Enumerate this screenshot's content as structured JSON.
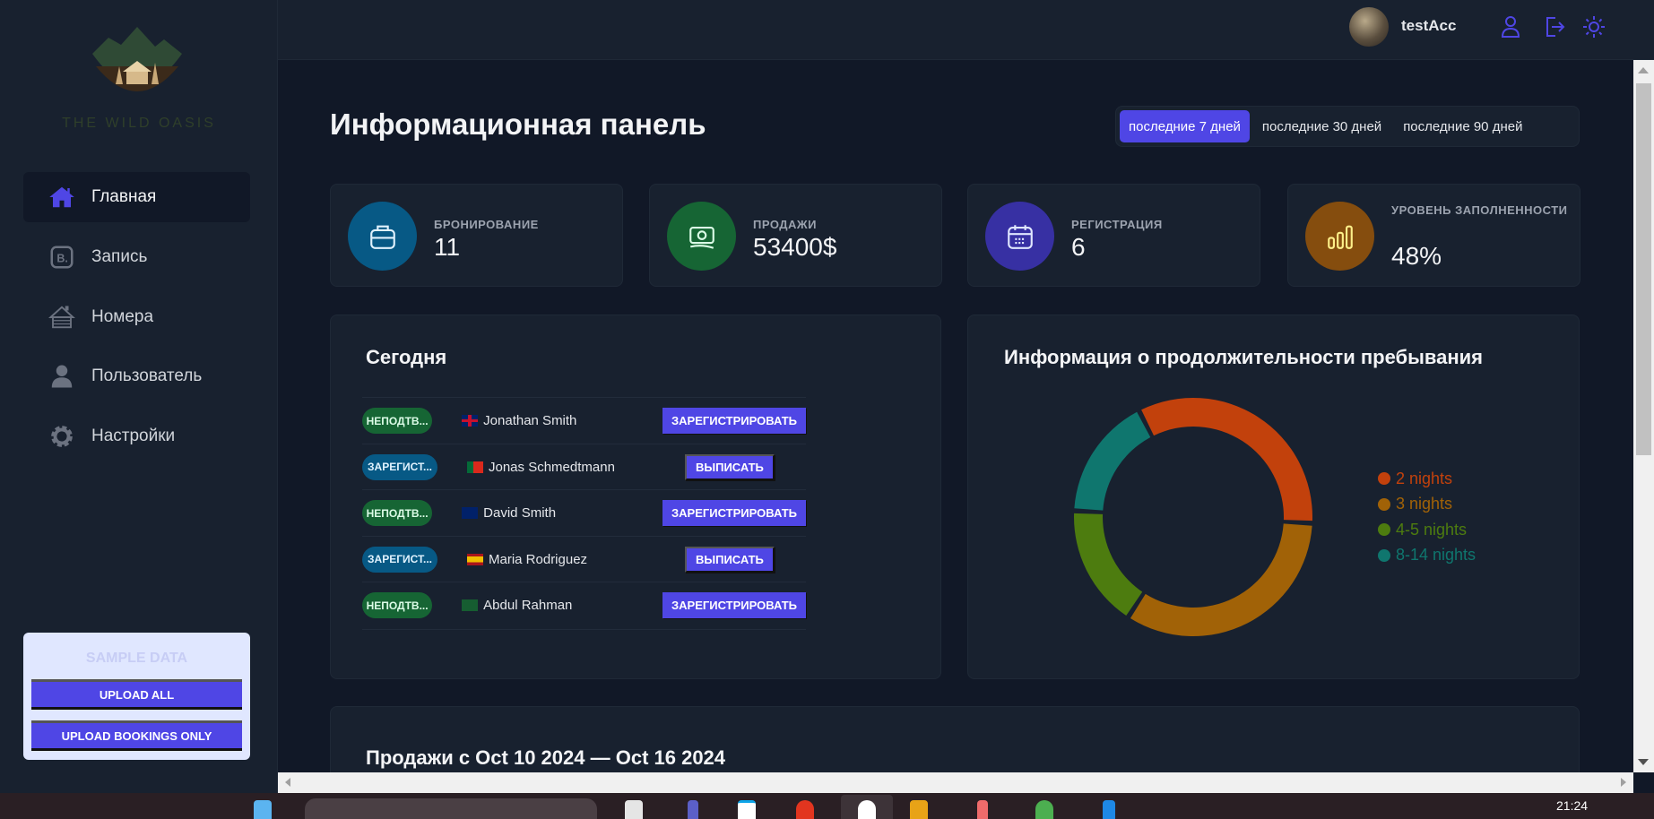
{
  "sidebar": {
    "logo_text": "THE WILD OASIS",
    "items": [
      {
        "label": "Главная",
        "icon": "home-icon",
        "active": true
      },
      {
        "label": "Запись",
        "icon": "bookings-icon"
      },
      {
        "label": "Номера",
        "icon": "cabin-icon"
      },
      {
        "label": "Пользователь",
        "icon": "user-icon"
      },
      {
        "label": "Настройки",
        "icon": "gear-icon"
      }
    ],
    "sample": {
      "title": "SAMPLE DATA",
      "upload_all": "UPLOAD ALL",
      "upload_bookings": "UPLOAD BOOKINGS ONLY"
    }
  },
  "header": {
    "username": "testAcc",
    "icons": [
      "user-icon",
      "logout-icon",
      "sun-icon"
    ]
  },
  "main": {
    "title": "Информационная панель",
    "filters": [
      "последние 7 дней",
      "последние 30 дней",
      "последние 90 дней"
    ],
    "active_filter": 0,
    "stats": [
      {
        "label": "БРОНИРОВАНИЕ",
        "value": "11",
        "color": "#075985",
        "icon": "briefcase-icon"
      },
      {
        "label": "ПРОДАЖИ",
        "value": "53400$",
        "color": "#166534",
        "icon": "banknote-icon"
      },
      {
        "label": "РЕГИСТРАЦИЯ",
        "value": "6",
        "color": "#3730a3",
        "icon": "calendar-icon"
      },
      {
        "label": "УРОВЕНЬ ЗАПОЛНЕННОСТИ",
        "value": "48%",
        "color": "#854d0e",
        "icon": "bar-chart-icon"
      }
    ],
    "today": {
      "title": "Сегодня",
      "rows": [
        {
          "status": "НЕПОДТВ...",
          "status_type": "unconfirmed",
          "flag": "gb",
          "guest": "Jonathan Smith",
          "action": "ЗАРЕГИСТРИРОВАТЬ"
        },
        {
          "status": "ЗАРЕГИСТ...",
          "status_type": "checked-in",
          "flag": "pt",
          "guest": "Jonas Schmedtmann",
          "action": "ВЫПИСАТЬ"
        },
        {
          "status": "НЕПОДТВ...",
          "status_type": "unconfirmed",
          "flag": "au",
          "guest": "David Smith",
          "action": "ЗАРЕГИСТРИРОВАТЬ"
        },
        {
          "status": "ЗАРЕГИСТ...",
          "status_type": "checked-in",
          "flag": "es",
          "guest": "Maria Rodriguez",
          "action": "ВЫПИСАТЬ"
        },
        {
          "status": "НЕПОДТВ...",
          "status_type": "unconfirmed",
          "flag": "sa",
          "guest": "Abdul Rahman",
          "action": "ЗАРЕГИСТРИРОВАТЬ"
        }
      ]
    },
    "duration": {
      "title": "Информация о продолжительности пребывания"
    },
    "sales": {
      "title": "Продажи с Oct 10 2024 — Oct 16 2024"
    }
  },
  "chart_data": {
    "type": "pie",
    "title": "Информация о продолжительности пребывания",
    "categories": [
      "2 nights",
      "3 nights",
      "4-5 nights",
      "8-14 nights"
    ],
    "values": [
      2,
      2,
      1,
      1
    ],
    "colors": [
      "#c2410c",
      "#a16207",
      "#4d7c0f",
      "#0f766e"
    ],
    "legend": "right"
  },
  "taskbar": {
    "time": "21:24"
  }
}
